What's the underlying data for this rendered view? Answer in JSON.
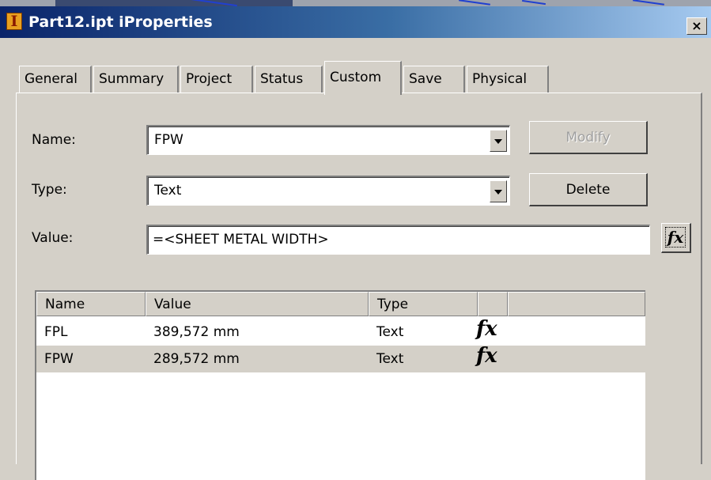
{
  "window": {
    "title": "Part12.ipt iProperties",
    "close_label": "×"
  },
  "tabs": [
    {
      "label": "General"
    },
    {
      "label": "Summary"
    },
    {
      "label": "Project"
    },
    {
      "label": "Status"
    },
    {
      "label": "Custom"
    },
    {
      "label": "Save"
    },
    {
      "label": "Physical"
    }
  ],
  "active_tab": "Custom",
  "form": {
    "name_label": "Name:",
    "name_value": "FPW",
    "type_label": "Type:",
    "type_value": "Text",
    "value_label": "Value:",
    "value_value": "=<SHEET METAL WIDTH>",
    "modify_label": "Modify",
    "delete_label": "Delete",
    "fx_button_glyph": "fx"
  },
  "table": {
    "columns": [
      "Name",
      "Value",
      "Type",
      ""
    ],
    "rows": [
      {
        "name": "FPL",
        "value": "389,572 mm",
        "type": "Text",
        "fx": "fx"
      },
      {
        "name": "FPW",
        "value": "289,572 mm",
        "type": "Text",
        "fx": "fx"
      }
    ]
  },
  "colors": {
    "titlebar_start": "#0a246a",
    "titlebar_end": "#a6caf0",
    "face": "#d4d0c8"
  },
  "icons": {
    "app": "inventor-app-icon",
    "formula": "fx-icon"
  }
}
